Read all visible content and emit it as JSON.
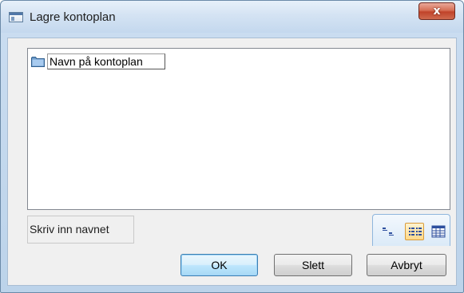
{
  "window": {
    "title": "Lagre kontoplan",
    "close_label": "x"
  },
  "list": {
    "items": [
      {
        "label": "Navn på kontoplan",
        "icon": "folder-icon"
      }
    ]
  },
  "status": {
    "text": "Skriv inn navnet"
  },
  "view_buttons": [
    {
      "icon": "small-icons-view-icon"
    },
    {
      "icon": "list-view-icon",
      "selected": true
    },
    {
      "icon": "details-view-icon"
    }
  ],
  "buttons": {
    "ok": "OK",
    "delete": "Slett",
    "cancel": "Avbryt"
  },
  "colors": {
    "ok_button_border": "#3c7fb1",
    "close_button": "#c0432a",
    "selected_view_button": "#ffd98a"
  }
}
